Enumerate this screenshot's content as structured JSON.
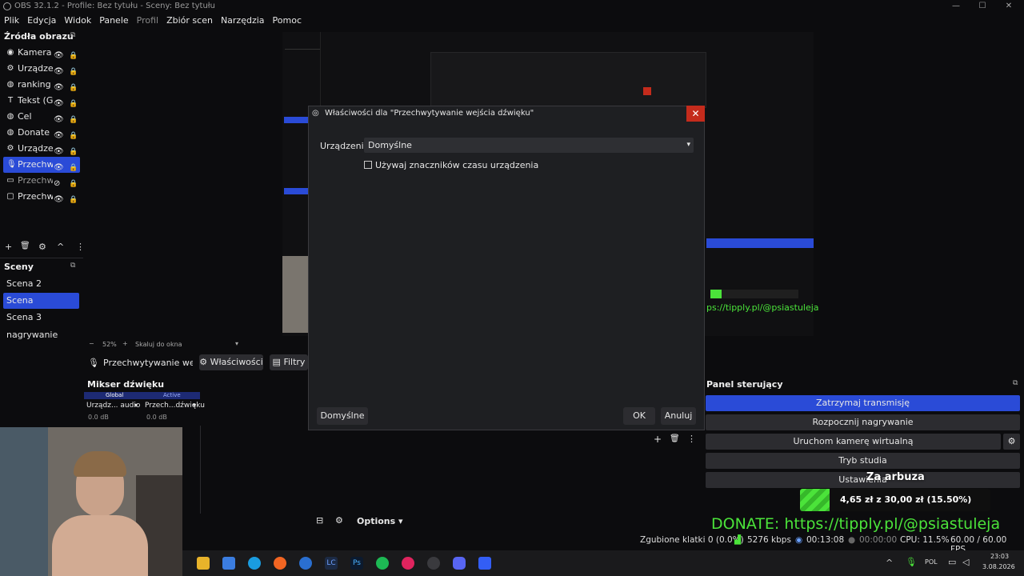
{
  "window": {
    "title": "OBS 32.1.2 - Profile: Bez tytułu - Sceny: Bez tytułu",
    "minimize": "—",
    "maximize": "☐",
    "close": "✕"
  },
  "menu": [
    "Plik",
    "Edycja",
    "Widok",
    "Panele",
    "Profil",
    "Zbiór scen",
    "Narzędzia",
    "Pomoc"
  ],
  "sources_dock": {
    "title": "Źródła obrazu",
    "items": [
      {
        "label": "Kamera i",
        "icon": "camera-icon"
      },
      {
        "label": "Urządzen",
        "icon": "gear-icon"
      },
      {
        "label": "ranking",
        "icon": "globe-icon"
      },
      {
        "label": "Tekst (GD",
        "icon": "text-icon"
      },
      {
        "label": "Cel",
        "icon": "globe-icon"
      },
      {
        "label": "Donate",
        "icon": "globe-icon"
      },
      {
        "label": "Urządzen",
        "icon": "gear-icon"
      },
      {
        "label": "Przechw",
        "icon": "microphone-icon",
        "selected": true
      },
      {
        "label": "Przechw",
        "icon": "window-icon",
        "dim": true
      },
      {
        "label": "Przechw",
        "icon": "monitor-icon"
      }
    ],
    "toolbar": [
      "+",
      "🗑",
      "⚙",
      "^",
      "⋮"
    ]
  },
  "scenes_dock": {
    "title": "Sceny",
    "items": [
      "Scena 2",
      "Scena",
      "Scena 3",
      "nagrywanie"
    ],
    "selected_index": 1
  },
  "preview_bar": {
    "zoom_minus": "−",
    "zoom": "52%",
    "zoom_plus": "+",
    "fit": "Skaluj do okna"
  },
  "source_toolbar": {
    "source_name": "Przechwytywanie wejśc",
    "properties": "Właściwości",
    "filters": "Filtry"
  },
  "mixer": {
    "title": "Mikser dźwięku",
    "tab_global": "Global",
    "tab_active": "Active",
    "channels": [
      {
        "name": "Urządz... audio",
        "level": "0.0 dB"
      },
      {
        "name": "Przech...dźwięku",
        "level": "0.0 dB"
      }
    ],
    "options": "Options"
  },
  "dialog": {
    "title": "Właściwości dla \"Przechwytywanie wejścia dźwięku\"",
    "device_label": "Urządzenie",
    "device_value": "Domyślne",
    "checkbox_label": "Używaj znaczników czasu urządzenia",
    "defaults_button": "Domyślne",
    "ok_button": "OK",
    "cancel_button": "Anuluj",
    "close": "✕"
  },
  "control_panel": {
    "title": "Panel sterujący",
    "buttons": [
      "Zatrzymaj transmisję",
      "Rozpocznij nagrywanie",
      "Uruchom kamerę wirtualną",
      "Tryb studia",
      "Ustawienia"
    ]
  },
  "overlay": {
    "goal_title": "Za arbuza",
    "goal_progress": "4,65 zł z 30,00 zł (15.50%)",
    "goal_fraction": 0.155,
    "donate_text": "DONATE: https://tipply.pl/@psiastuleja"
  },
  "status_bar": {
    "dropped": "Zgubione klatki 0 (0.0%)",
    "bitrate": "5276 kbps",
    "stream_time": "00:13:08",
    "rec_time": "00:00:00",
    "cpu": "CPU: 11.5%",
    "fps": "60.00 / 60.00 FPS"
  },
  "tray": {
    "lang": "POL",
    "time": "23:03",
    "date": "3.08.2026"
  },
  "colors": {
    "accent": "#2a4bd7",
    "close_red": "#c42b1c",
    "donate_green": "#4be33a"
  }
}
